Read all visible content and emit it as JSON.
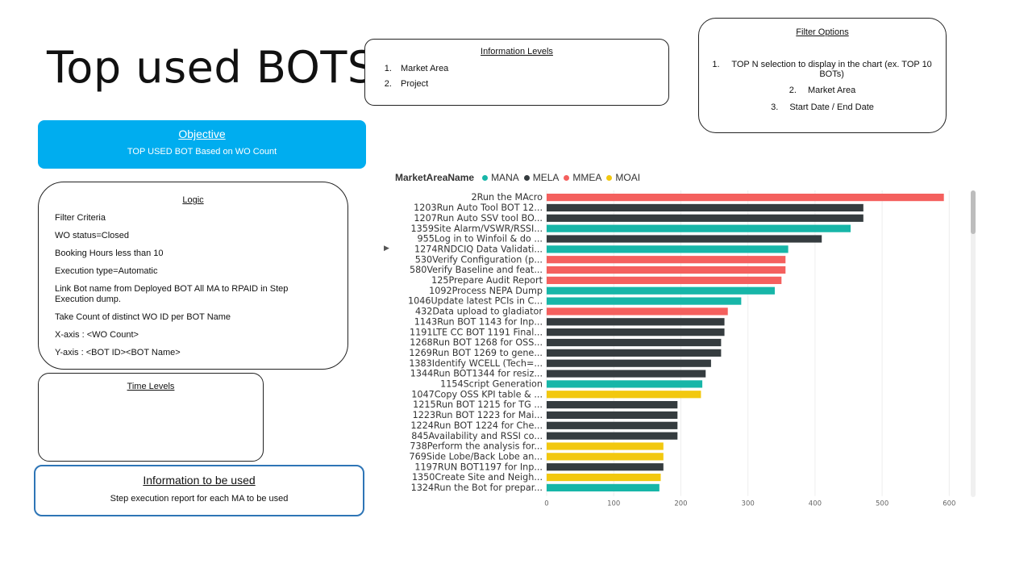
{
  "title": "Top used BOTS",
  "info_levels": {
    "heading": "Information Levels",
    "items": [
      "Market Area",
      "Project"
    ]
  },
  "filter_options": {
    "heading": "Filter Options",
    "items": [
      "TOP N selection to display in the chart (ex. TOP 10 BOTs)",
      "Market Area",
      "Start Date / End Date"
    ]
  },
  "objective": {
    "heading": "Objective",
    "text": "TOP USED BOT Based on WO Count"
  },
  "logic": {
    "heading": "Logic",
    "lines": [
      "Filter Criteria",
      "WO status=Closed",
      "Booking Hours less than 10",
      "Execution type=Automatic",
      "Link Bot name from Deployed BOT All MA to RPAID in Step Execution dump.",
      "Take Count of distinct WO ID per BOT Name",
      "X-axis : <WO Count>",
      "Y-axis : <BOT ID><BOT Name>"
    ]
  },
  "time_levels": {
    "heading": "Time Levels"
  },
  "info_used": {
    "heading": "Information  to be used",
    "text": "Step execution report for each MA to be used"
  },
  "legend": {
    "title": "MarketAreaName",
    "items": [
      {
        "name": "MANA",
        "color": "#17b6a8"
      },
      {
        "name": "MELA",
        "color": "#353c3f"
      },
      {
        "name": "MMEA",
        "color": "#f4605e"
      },
      {
        "name": "MOAI",
        "color": "#f2c80f"
      }
    ]
  },
  "chart_data": {
    "type": "bar",
    "orientation": "horizontal",
    "xlim": [
      0,
      620
    ],
    "xticks": [
      0,
      100,
      200,
      300,
      400,
      500,
      600
    ],
    "grid": true,
    "legend_position": "top-left",
    "bars": [
      {
        "label": "2Run the MAcro",
        "value": 592,
        "area": "MMEA"
      },
      {
        "label": "1203Run Auto Tool BOT 12...",
        "value": 472,
        "area": "MELA"
      },
      {
        "label": "1207Run Auto SSV tool BO...",
        "value": 472,
        "area": "MELA"
      },
      {
        "label": "1359Site Alarm/VSWR/RSSI...",
        "value": 453,
        "area": "MANA"
      },
      {
        "label": "955Log in to Winfoil & do ...",
        "value": 410,
        "area": "MELA"
      },
      {
        "label": "1274RNDCIQ Data Validati...",
        "value": 360,
        "area": "MANA"
      },
      {
        "label": "530Verify Configuration (p...",
        "value": 356,
        "area": "MMEA"
      },
      {
        "label": "580Verify Baseline and feat...",
        "value": 356,
        "area": "MMEA"
      },
      {
        "label": "125Prepare Audit Report",
        "value": 350,
        "area": "MMEA"
      },
      {
        "label": "1092Process NEPA Dump",
        "value": 340,
        "area": "MANA"
      },
      {
        "label": "1046Update latest PCIs in C...",
        "value": 290,
        "area": "MANA"
      },
      {
        "label": "432Data upload to gladiator",
        "value": 270,
        "area": "MMEA"
      },
      {
        "label": "1143Run BOT 1143 for Inp...",
        "value": 265,
        "area": "MELA"
      },
      {
        "label": "1191LTE CC BOT 1191 Final...",
        "value": 265,
        "area": "MELA"
      },
      {
        "label": "1268Run BOT 1268 for OSS...",
        "value": 260,
        "area": "MELA"
      },
      {
        "label": "1269Run BOT 1269 to gene...",
        "value": 260,
        "area": "MELA"
      },
      {
        "label": "1383Identify WCELL (Tech=...",
        "value": 245,
        "area": "MELA"
      },
      {
        "label": "1344Run BOT1344 for resiz...",
        "value": 237,
        "area": "MELA"
      },
      {
        "label": "1154Script Generation",
        "value": 232,
        "area": "MANA"
      },
      {
        "label": "1047Copy OSS KPI table & ...",
        "value": 230,
        "area": "MOAI"
      },
      {
        "label": "1215Run BOT 1215 for TG ...",
        "value": 195,
        "area": "MELA"
      },
      {
        "label": "1223Run BOT 1223 for Mai...",
        "value": 195,
        "area": "MELA"
      },
      {
        "label": "1224Run BOT 1224 for Che...",
        "value": 195,
        "area": "MELA"
      },
      {
        "label": "845Availability and RSSI co...",
        "value": 195,
        "area": "MELA"
      },
      {
        "label": "738Perform the analysis for...",
        "value": 174,
        "area": "MOAI"
      },
      {
        "label": "769Side Lobe/Back Lobe an...",
        "value": 174,
        "area": "MOAI"
      },
      {
        "label": "1197RUN BOT1197 for Inp...",
        "value": 174,
        "area": "MELA"
      },
      {
        "label": "1350Create Site and Neigh...",
        "value": 170,
        "area": "MOAI"
      },
      {
        "label": "1324Run the Bot for prepar...",
        "value": 168,
        "area": "MANA"
      }
    ]
  }
}
